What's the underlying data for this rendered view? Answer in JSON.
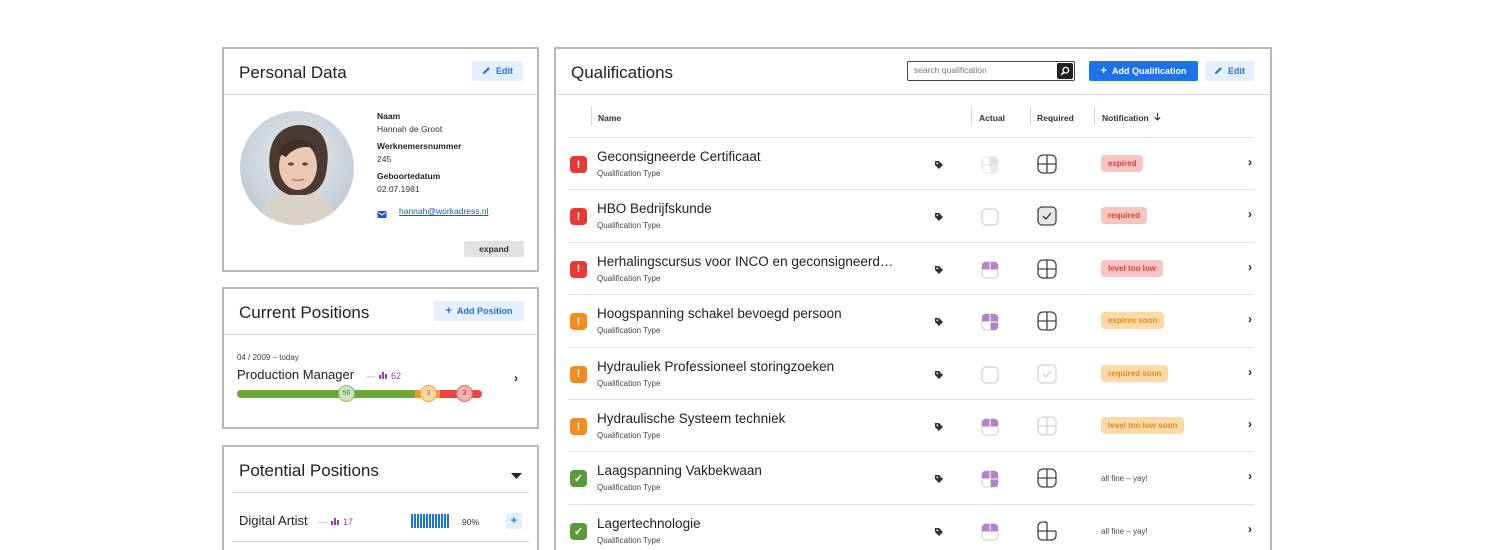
{
  "personal": {
    "title": "Personal Data",
    "edit_label": "Edit",
    "fields": [
      {
        "label": "Naam",
        "value": "Hannah de Groot"
      },
      {
        "label": "Werknemersnummer",
        "value": "245"
      },
      {
        "label": "Geboortedatum",
        "value": "02.07.1981"
      }
    ],
    "email": "hannah@workadress.nl",
    "expand_label": "expand"
  },
  "current": {
    "title": "Current Positions",
    "add_label": "Add Position",
    "item": {
      "date": "04 / 2009 – today",
      "name": "Production Manager",
      "count": "62",
      "segments": [
        {
          "label": "56",
          "color": "#6aa83c",
          "fraction": 0.72
        },
        {
          "label": "3",
          "color": "#f39a2b",
          "fraction": 0.14
        },
        {
          "label": "3",
          "color": "#e8463f",
          "fraction": 0.14
        }
      ]
    }
  },
  "potential": {
    "title": "Potential Positions",
    "item": {
      "name": "Digital Artist",
      "count": "17",
      "percent": "90%",
      "plus": "+"
    }
  },
  "qualifications": {
    "title": "Qualifications",
    "search_placeholder": "search qualification",
    "add_label": "Add Qualification",
    "edit_label": "Edit",
    "columns": {
      "name": "Name",
      "actual": "Actual",
      "required": "Required",
      "notification": "Notification"
    },
    "colors": {
      "red": "#e53935",
      "orange": "#f58a1f",
      "green": "#5b9a3a",
      "purple": "#b383c9"
    },
    "rows": [
      {
        "name": "Geconsigneerde Certificaat",
        "type": "Qualification Type",
        "status": "red",
        "actual": "faded",
        "required": "quadrant",
        "note": "expired",
        "note_style": "red"
      },
      {
        "name": "HBO Bedrijfskunde",
        "type": "Qualification Type",
        "status": "red",
        "actual": "empty",
        "required": "check",
        "note": "required",
        "note_style": "red"
      },
      {
        "name": "Herhalingscursus voor INCO en geconsigneerd…",
        "type": "Qualification Type",
        "status": "red",
        "actual": "half",
        "required": "quadrant",
        "note": "level too low",
        "note_style": "red"
      },
      {
        "name": "Hoogspanning schakel bevoegd persoon",
        "type": "Qualification Type",
        "status": "orange",
        "actual": "three",
        "required": "quadrant",
        "note": "expires soon",
        "note_style": "orange"
      },
      {
        "name": "Hydrauliek Professioneel storingzoeken",
        "type": "Qualification Type",
        "status": "orange",
        "actual": "empty",
        "required": "check-faded",
        "note": "required soon",
        "note_style": "orange"
      },
      {
        "name": "Hydraulische Systeem techniek",
        "type": "Qualification Type",
        "status": "orange",
        "actual": "half",
        "required": "quadrant-faded",
        "note": "level too low soon",
        "note_style": "orange"
      },
      {
        "name": "Laagspanning Vakbekwaan",
        "type": "Qualification Type",
        "status": "green",
        "actual": "three",
        "required": "quadrant",
        "note": "all fine – yay!",
        "note_style": "plain"
      },
      {
        "name": "Lagertechnologie",
        "type": "Qualification Type",
        "status": "green",
        "actual": "half",
        "required": "quadrant-partial",
        "note": "all fine – yay!",
        "note_style": "plain"
      }
    ]
  }
}
